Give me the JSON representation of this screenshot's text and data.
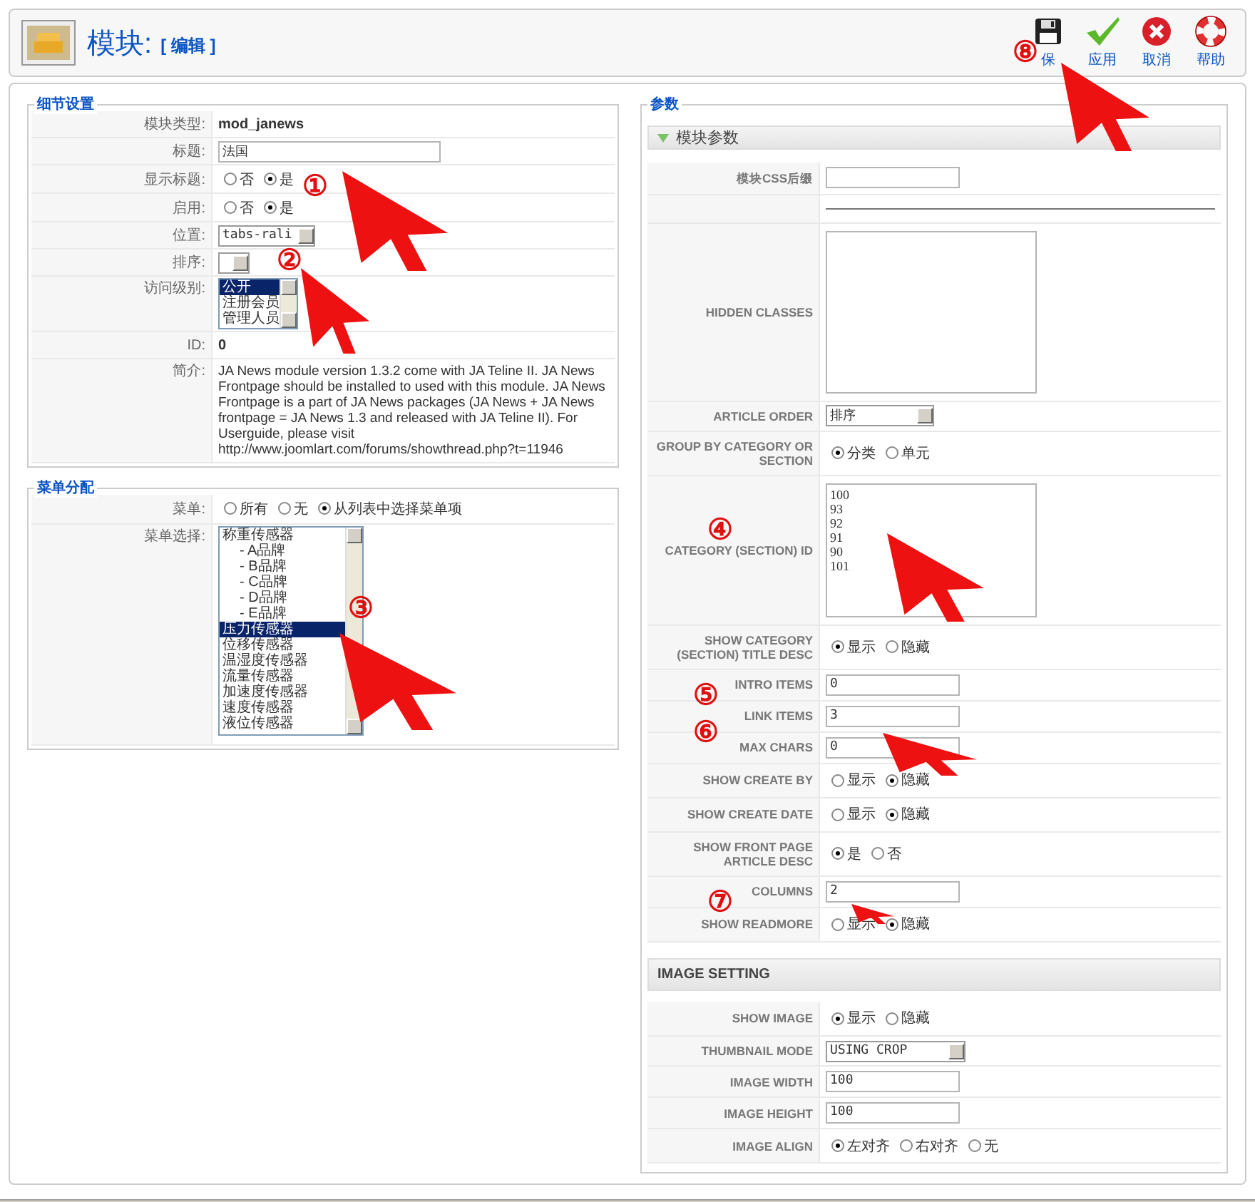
{
  "header": {
    "title": "模块:",
    "subtitle": "[ 编辑 ]",
    "toolbar": [
      {
        "label": "保"
      },
      {
        "label": "应用"
      },
      {
        "label": "取消"
      },
      {
        "label": "帮助"
      }
    ]
  },
  "details": {
    "legend": "细节设置",
    "rows": [
      {
        "kind": "text",
        "label": "模块类型:",
        "value": "mod_janews"
      },
      {
        "kind": "input",
        "label": "标题:",
        "value": "法国"
      },
      {
        "kind": "radio",
        "label": "显示标题:",
        "options": [
          {
            "label": "否",
            "selected": false
          },
          {
            "label": "是",
            "selected": true
          }
        ]
      },
      {
        "kind": "radio",
        "label": "启用:",
        "options": [
          {
            "label": "否",
            "selected": false
          },
          {
            "label": "是",
            "selected": true
          }
        ]
      },
      {
        "kind": "select",
        "label": "位置:",
        "value": "tabs-rali"
      },
      {
        "kind": "select",
        "label": "排序:"
      },
      {
        "kind": "listbox",
        "label": "访问级别:",
        "items": [
          {
            "label": "公开",
            "selected": true
          },
          {
            "label": "注册会员",
            "selected": false
          },
          {
            "label": "管理人员",
            "selected": false
          }
        ]
      },
      {
        "kind": "text",
        "label": "ID:",
        "value": "0"
      },
      {
        "kind": "paragraph",
        "label": "简介:",
        "value": "JA News module version 1.3.2 come with JA Teline II. JA News Frontpage should be installed to used with this module. JA News Frontpage is a part of JA News packages (JA News + JA News frontpage = JA News 1.3 and released with JA Teline II). For Userguide, please visit http://www.joomlart.com/forums/showthread.php?t=11946"
      }
    ]
  },
  "menu_assignment": {
    "legend": "菜单分配",
    "rows": [
      {
        "kind": "radio",
        "label": "菜单:",
        "options": [
          {
            "label": "所有",
            "selected": false
          },
          {
            "label": "无",
            "selected": false
          },
          {
            "label": "从列表中选择菜单项",
            "selected": true
          }
        ]
      },
      {
        "kind": "listbox",
        "label": "菜单选择:",
        "items": [
          {
            "label": "称重传感器",
            "selected": false,
            "children": [
              {
                "label": "- A品牌",
                "selected": false
              },
              {
                "label": "- B品牌",
                "selected": false
              },
              {
                "label": "- C品牌",
                "selected": false
              },
              {
                "label": "- D品牌",
                "selected": false
              },
              {
                "label": "- E品牌",
                "selected": false
              }
            ]
          },
          {
            "label": "压力传感器",
            "selected": true
          },
          {
            "label": "位移传感器",
            "selected": false
          },
          {
            "label": "温湿度传感器",
            "selected": false
          },
          {
            "label": "流量传感器",
            "selected": false
          },
          {
            "label": "加速度传感器",
            "selected": false
          },
          {
            "label": "速度传感器",
            "selected": false
          },
          {
            "label": "液位传感器",
            "selected": false
          }
        ]
      }
    ]
  },
  "params": {
    "legend": "参数",
    "sections": [
      {
        "title": "模块参数",
        "expanded": true,
        "rows": [
          {
            "kind": "input",
            "label": "模块CSS后缀"
          },
          {
            "kind": "separator"
          },
          {
            "kind": "textarea",
            "label": "HIDDEN CLASSES"
          },
          {
            "kind": "select",
            "label": "ARTICLE ORDER",
            "value": "排序"
          },
          {
            "kind": "radio",
            "label": "GROUP BY CATEGORY OR SECTION",
            "options": [
              {
                "label": "分类",
                "selected": true
              },
              {
                "label": "单元",
                "selected": false
              }
            ]
          },
          {
            "kind": "textarea",
            "label": "CATEGORY (SECTION) ID",
            "lines": [
              "100",
              "93",
              "92",
              "91",
              "90",
              "101"
            ]
          },
          {
            "kind": "radio",
            "label": "SHOW CATEGORY (SECTION) TITLE DESC",
            "options": [
              {
                "label": "显示",
                "selected": true
              },
              {
                "label": "隐藏",
                "selected": false
              }
            ]
          },
          {
            "kind": "input",
            "label": "INTRO ITEMS",
            "value": "0"
          },
          {
            "kind": "input",
            "label": "LINK ITEMS",
            "value": "3"
          },
          {
            "kind": "input",
            "label": "MAX CHARS",
            "value": "0"
          },
          {
            "kind": "radio",
            "label": "SHOW CREATE BY",
            "options": [
              {
                "label": "显示",
                "selected": false
              },
              {
                "label": "隐藏",
                "selected": true
              }
            ]
          },
          {
            "kind": "radio",
            "label": "SHOW CREATE DATE",
            "options": [
              {
                "label": "显示",
                "selected": false
              },
              {
                "label": "隐藏",
                "selected": true
              }
            ]
          },
          {
            "kind": "radio",
            "label": "SHOW FRONT PAGE ARTICLE DESC",
            "options": [
              {
                "label": "是",
                "selected": true
              },
              {
                "label": "否",
                "selected": false
              }
            ]
          },
          {
            "kind": "input",
            "label": "COLUMNS",
            "value": "2"
          },
          {
            "kind": "radio",
            "label": "SHOW READMORE",
            "options": [
              {
                "label": "显示",
                "selected": false
              },
              {
                "label": "隐藏",
                "selected": true
              }
            ]
          }
        ]
      },
      {
        "title": "IMAGE SETTING",
        "rows": [
          {
            "kind": "radio",
            "label": "SHOW IMAGE",
            "options": [
              {
                "label": "显示",
                "selected": true
              },
              {
                "label": "隐藏",
                "selected": false
              }
            ]
          },
          {
            "kind": "select",
            "label": "THUMBNAIL MODE",
            "value": "USING CROP"
          },
          {
            "kind": "input",
            "label": "IMAGE WIDTH",
            "value": "100"
          },
          {
            "kind": "input",
            "label": "IMAGE HEIGHT",
            "value": "100"
          },
          {
            "kind": "radio",
            "label": "IMAGE ALIGN",
            "options": [
              {
                "label": "左对齐",
                "selected": true
              },
              {
                "label": "右对齐",
                "selected": false
              },
              {
                "label": "无",
                "selected": false
              }
            ]
          }
        ]
      }
    ]
  },
  "annotations": [
    {
      "number": "①"
    },
    {
      "number": "②"
    },
    {
      "number": "③"
    },
    {
      "number": "④"
    },
    {
      "number": "⑤"
    },
    {
      "number": "⑥"
    },
    {
      "number": "⑦"
    },
    {
      "number": "⑧"
    }
  ]
}
